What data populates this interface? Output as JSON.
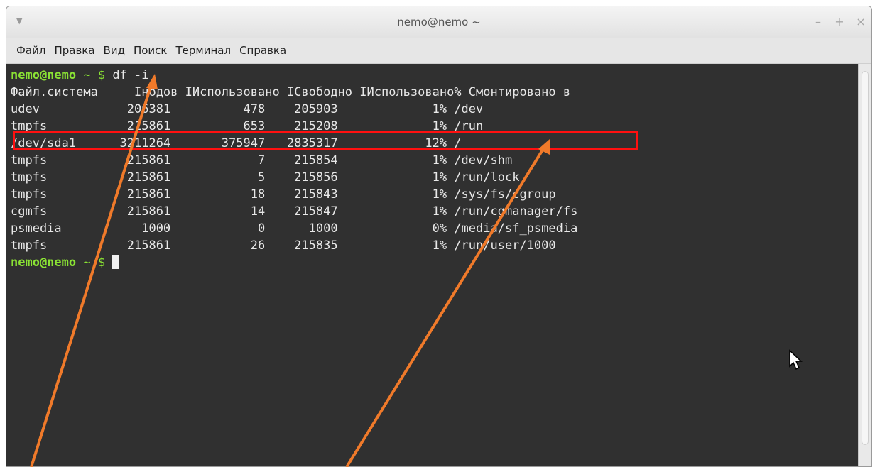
{
  "window": {
    "title": "nemo@nemo ~",
    "menu_icon": "▼",
    "controls": {
      "minimize": "–",
      "maximize": "+",
      "close": "×"
    }
  },
  "menu": {
    "items": [
      "Файл",
      "Правка",
      "Вид",
      "Поиск",
      "Терминал",
      "Справка"
    ]
  },
  "terminal": {
    "prompt_user": "nemo@nemo",
    "prompt_rest": " ~ $ ",
    "command": "df -i",
    "header": "Файл.система     Інодов ІИспользовано ІСвободно ІИспользовано% Смонтировано в",
    "rows": [
      "udev            206381          478    205903             1% /dev",
      "tmpfs           215861          653    215208             1% /run",
      "/dev/sda1      3211264       375947   2835317            12% /",
      "tmpfs           215861            7    215854             1% /dev/shm",
      "tmpfs           215861            5    215856             1% /run/lock",
      "tmpfs           215861           18    215843             1% /sys/fs/cgroup",
      "cgmfs           215861           14    215847             1% /run/cgmanager/fs",
      "psmedia           1000            0      1000             0% /media/sf_psmedia",
      "tmpfs           215861           26    215835             1% /run/user/1000"
    ]
  },
  "colors": {
    "terminal_bg": "#303030",
    "prompt": "#8ae234",
    "highlight": "#ff1010",
    "annotation_arrow": "#f07a2a"
  }
}
